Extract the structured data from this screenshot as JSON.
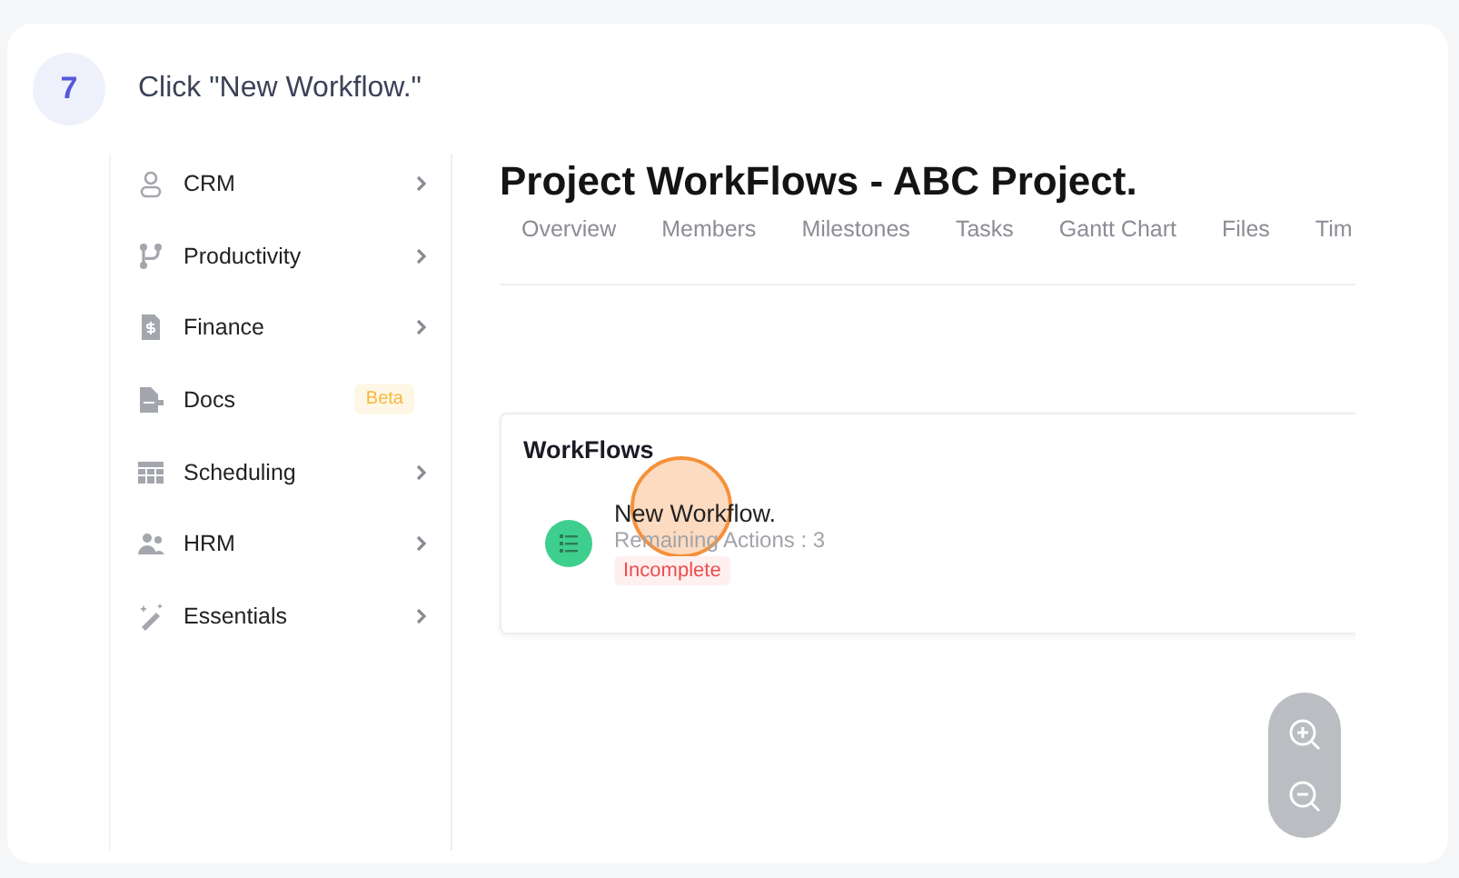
{
  "step": {
    "number": "7",
    "instruction": "Click \"New Workflow.\""
  },
  "sidebar": {
    "items": [
      {
        "label": "CRM",
        "chevron": true
      },
      {
        "label": "Productivity",
        "chevron": true
      },
      {
        "label": "Finance",
        "chevron": true
      },
      {
        "label": "Docs",
        "chevron": false,
        "badge": "Beta"
      },
      {
        "label": "Scheduling",
        "chevron": true
      },
      {
        "label": "HRM",
        "chevron": true
      },
      {
        "label": "Essentials",
        "chevron": true
      }
    ]
  },
  "page": {
    "title": "Project WorkFlows - ABC Project.",
    "tabs": [
      "Overview",
      "Members",
      "Milestones",
      "Tasks",
      "Gantt Chart",
      "Files",
      "Tim"
    ],
    "workflows": {
      "heading": "WorkFlows",
      "items": [
        {
          "name": "New Workflow.",
          "remaining": "Remaining Actions : 3",
          "status": "Incomplete"
        }
      ]
    }
  }
}
